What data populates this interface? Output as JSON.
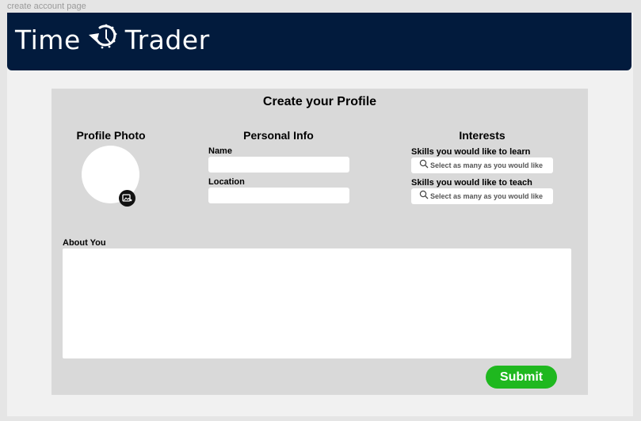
{
  "frame_label": "create account page",
  "brand": {
    "name_left": "Time",
    "name_right": "Trader",
    "colors": {
      "header_bg": "#021b3d",
      "accent_green": "#1fb81f",
      "card_bg": "#d9d9d9"
    }
  },
  "form": {
    "title": "Create your Profile",
    "photo": {
      "heading": "Profile Photo",
      "upload_icon": "image-upload-icon"
    },
    "personal": {
      "heading": "Personal Info",
      "name_label": "Name",
      "name_value": "",
      "location_label": "Location",
      "location_value": ""
    },
    "interests": {
      "heading": "Interests",
      "learn_label": "Skills you would like to learn",
      "learn_placeholder": "Select as many as you would like",
      "teach_label": "Skills you would like to teach",
      "teach_placeholder": "Select as many as you would like",
      "search_icon": "search-icon"
    },
    "about": {
      "label": "About You",
      "value": ""
    },
    "submit_label": "Submit"
  }
}
